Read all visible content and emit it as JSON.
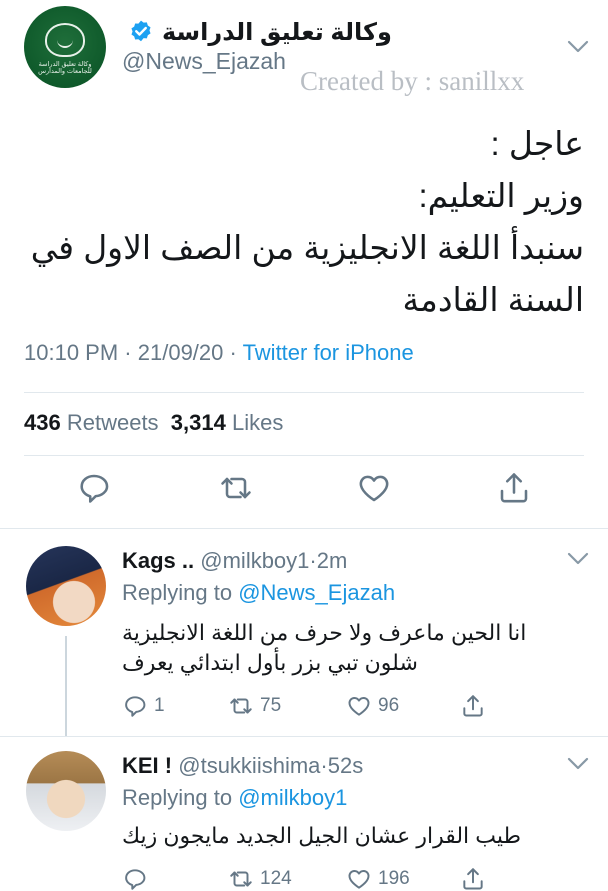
{
  "tweet": {
    "display_name": "وكالة تعليق الدراسة",
    "handle": "@News_Ejazah",
    "watermark": "Created by : sanillxx",
    "avatar_text_1": "وكالة تعليق الدراسة",
    "avatar_text_2": "للجامعات والمدارس",
    "text_lines": [
      "عاجل :",
      "وزير التعليم:",
      "سنبدأ اللغة الانجليزية من الصف الاول في",
      "السنة القادمة"
    ],
    "time": "10:10 PM",
    "date": "21/09/20",
    "dot": "·",
    "source": "Twitter for iPhone",
    "retweets_count": "436",
    "retweets_label": "Retweets",
    "likes_count": "3,314",
    "likes_label": "Likes",
    "action_icons": [
      "reply-icon",
      "retweet-icon",
      "like-icon",
      "share-icon"
    ]
  },
  "replies": [
    {
      "name": "Kags ..",
      "handle": "@milkboy1",
      "time": "2m",
      "replying_prefix": "Replying to",
      "replying_to": "@News_Ejazah",
      "text_lines": [
        "انا الحين ماعرف ولا حرف من اللغة الانجليزية",
        "شلون تبي بزر بأول ابتدائي يعرف"
      ],
      "reply_count": "1",
      "retweet_count": "75",
      "like_count": "96"
    },
    {
      "name": "KEI !",
      "handle": "@tsukkiishima",
      "time": "52s",
      "replying_prefix": "Replying to",
      "replying_to": "@milkboy1",
      "text_lines": [
        "طيب القرار عشان الجيل الجديد مايجون زيك"
      ],
      "reply_count": "",
      "retweet_count": "124",
      "like_count": "196"
    }
  ],
  "colors": {
    "text": "#14171a",
    "secondary": "#657786",
    "link": "#1b95e0",
    "divider": "#e1e8ed",
    "verified": "#1da1f2"
  }
}
